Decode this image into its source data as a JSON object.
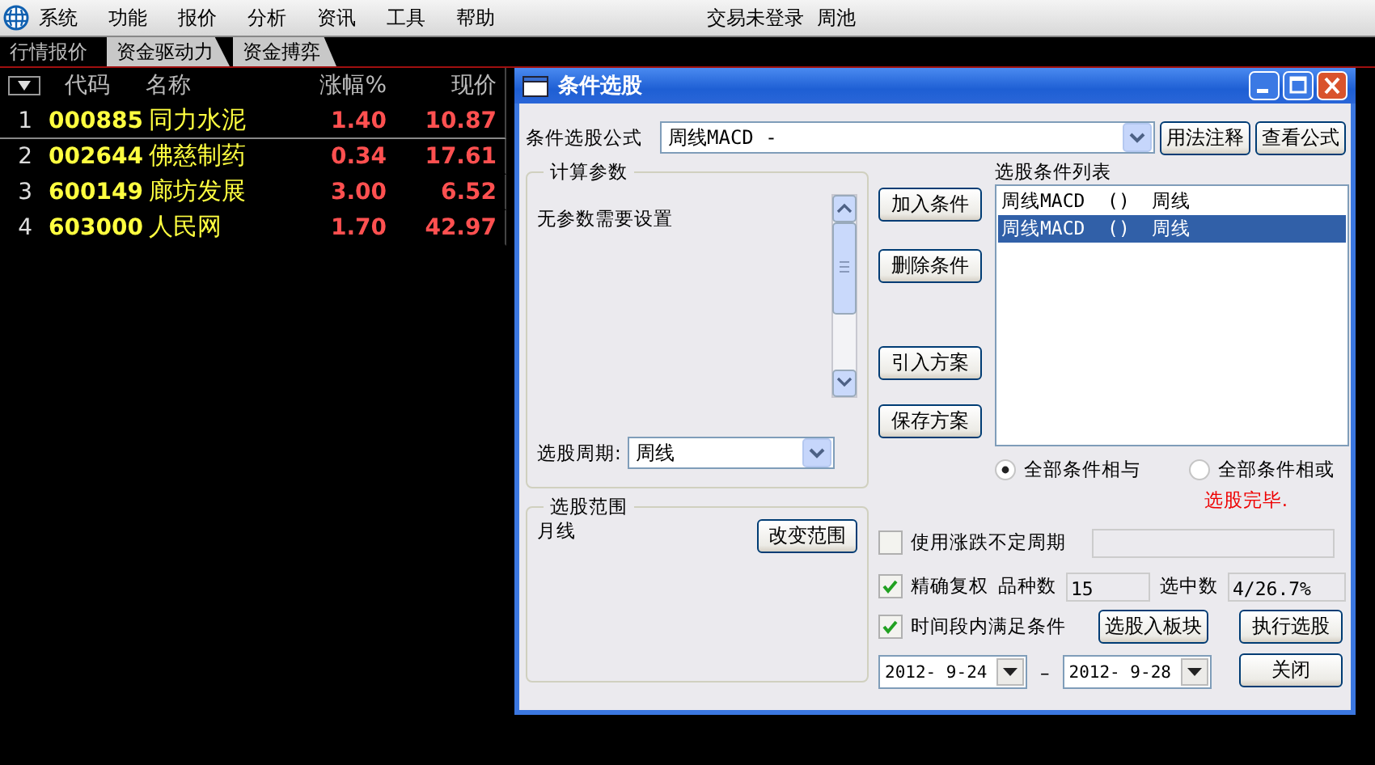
{
  "menu": [
    "系统",
    "功能",
    "报价",
    "分析",
    "资讯",
    "工具",
    "帮助"
  ],
  "status": {
    "login": "交易未登录",
    "user": "周池"
  },
  "tabs": [
    {
      "label": "行情报价",
      "selected": true
    },
    {
      "label": "资金驱动力",
      "selected": false
    },
    {
      "label": "资金搏弈",
      "selected": false
    }
  ],
  "table": {
    "columns": [
      "代码",
      "名称",
      "涨幅%",
      "现价"
    ],
    "rows": [
      {
        "index": "1",
        "code": "000885",
        "name": "同力水泥",
        "change": "1.40",
        "price": "10.87",
        "selected": true
      },
      {
        "index": "2",
        "code": "002644",
        "name": "佛慈制药",
        "change": "0.34",
        "price": "17.61",
        "selected": false
      },
      {
        "index": "3",
        "code": "600149",
        "name": "廊坊发展",
        "change": "3.00",
        "price": "6.52",
        "selected": false
      },
      {
        "index": "4",
        "code": "603000",
        "name": "人民网",
        "change": "1.70",
        "price": "42.97",
        "selected": false
      }
    ]
  },
  "dialog": {
    "title": "条件选股",
    "formula": {
      "label": "条件选股公式",
      "value": "周线MACD -"
    },
    "top_buttons": [
      "用法注释",
      "查看公式"
    ],
    "params": {
      "title": "计算参数",
      "message": "无参数需要设置"
    },
    "period": {
      "label": "选股周期:",
      "value": "周线"
    },
    "side_buttons": [
      "加入条件",
      "删除条件",
      "引入方案",
      "保存方案"
    ],
    "list": {
      "label": "选股条件列表",
      "items": [
        {
          "text": "周线MACD  ()  周线",
          "selected": false
        },
        {
          "text": "周线MACD  ()  周线",
          "selected": true
        }
      ]
    },
    "logic": [
      {
        "label": "全部条件相与",
        "selected": true
      },
      {
        "label": "全部条件相或",
        "selected": false
      }
    ],
    "result": "选股完毕.",
    "scope": {
      "title": "选股范围",
      "value": "月线",
      "button": "改变范围"
    },
    "variable_period": {
      "label": "使用涨跌不定周期",
      "checked": false
    },
    "exact": {
      "label": "精确复权",
      "checked": true
    },
    "count": {
      "label": "品种数",
      "value": "15"
    },
    "selected_count": {
      "label": "选中数",
      "value": "4/26.7%"
    },
    "in_range": {
      "label": "时间段内满足条件",
      "checked": true
    },
    "dates": {
      "from": "2012- 9-24",
      "separator": "–",
      "to": "2012- 9-28"
    },
    "bottom_buttons": [
      "选股入板块",
      "执行选股",
      "关闭"
    ]
  }
}
